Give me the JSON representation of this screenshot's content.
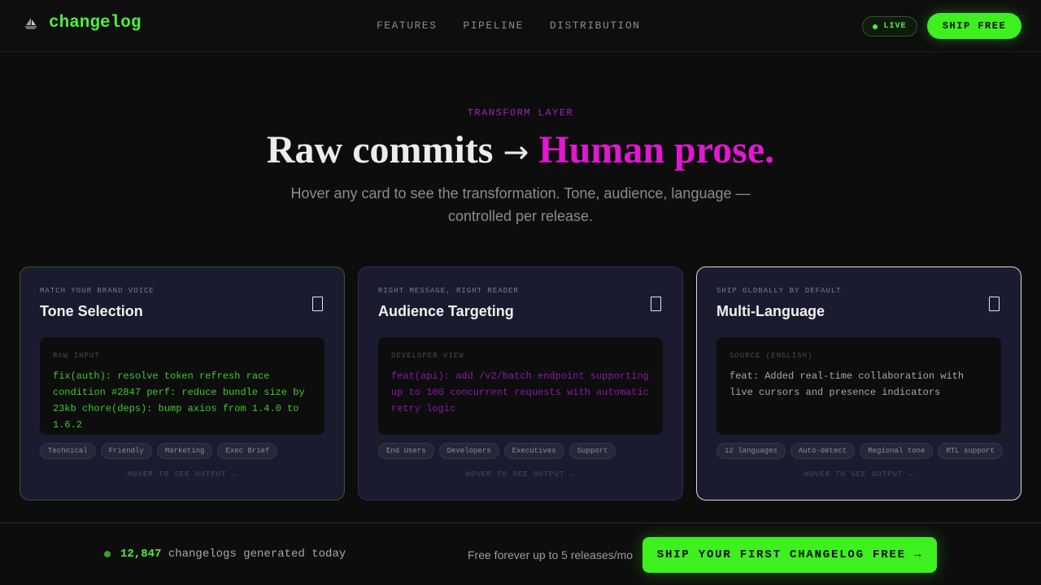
{
  "nav": {
    "logo_icon": "ship-icon",
    "logo_text": "changelog",
    "links": [
      "FEATURES",
      "PIPELINE",
      "DISTRIBUTION"
    ],
    "live_label": "LIVE",
    "ship_free_label": "SHIP FREE"
  },
  "hero": {
    "eyebrow": "TRANSFORM LAYER",
    "headline_a": "Raw commits",
    "headline_arrow": "→",
    "headline_b": "Human prose.",
    "subtitle": "Hover any card to see the transformation. Tone, audience, language — controlled per release."
  },
  "cards": [
    {
      "kicker": "MATCH YOUR BRAND VOICE",
      "title": "Tone Selection",
      "code_label": "RAW INPUT",
      "code_text": "fix(auth): resolve token refresh race condition #2847 perf: reduce bundle size by 23kb chore(deps): bump axios from 1.4.0 to 1.6.2",
      "chips": [
        "Technical",
        "Friendly",
        "Marketing",
        "Exec Brief"
      ],
      "hint": "HOVER TO SEE OUTPUT →"
    },
    {
      "kicker": "RIGHT MESSAGE, RIGHT READER",
      "title": "Audience Targeting",
      "code_label": "DEVELOPER VIEW",
      "code_text": "feat(api): add /v2/batch endpoint supporting up to 100 concurrent requests with automatic retry logic",
      "chips": [
        "End Users",
        "Developers",
        "Executives",
        "Support"
      ],
      "hint": "HOVER TO SEE OUTPUT →"
    },
    {
      "kicker": "SHIP GLOBALLY BY DEFAULT",
      "title": "Multi-Language",
      "code_label": "SOURCE (ENGLISH)",
      "code_text": "feat: Added real-time collaboration with live cursors and presence indicators",
      "chips": [
        "12 languages",
        "Auto-detect",
        "Regional tone",
        "RTL support"
      ],
      "hint": "HOVER TO SEE OUTPUT →"
    }
  ],
  "footer": {
    "stat_number": "12,847",
    "stat_text": "changelogs generated today",
    "free_note": "Free forever up to 5 releases/mo",
    "cta_label": "SHIP YOUR FIRST CHANGELOG FREE →"
  },
  "colors": {
    "accent_green": "#3ef01e",
    "accent_magenta": "#e018d0",
    "background": "#0d0d0d",
    "card_bg": "#1a1b2e"
  }
}
